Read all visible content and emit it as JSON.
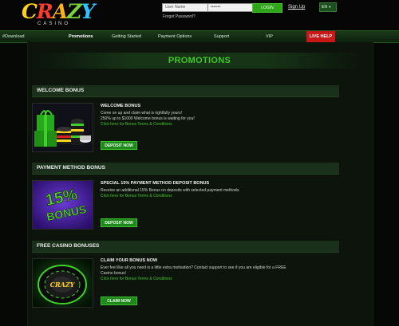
{
  "header": {
    "logo_main": "CRAZY",
    "logo_sub": "CASINO",
    "username_placeholder": "User Name",
    "password_placeholder": "•••••••",
    "login_label": "LOGIN",
    "signup_label": "Sign Up",
    "language": "EN",
    "forgot_password": "Forgot Password?"
  },
  "nav": {
    "items": [
      {
        "label": "#Download"
      },
      {
        "label": "Promotions"
      },
      {
        "label": "Getting Started"
      },
      {
        "label": "Payment Options"
      },
      {
        "label": "Support"
      },
      {
        "label": "VIP"
      }
    ],
    "live_help": "LIVE HELP"
  },
  "page_title": "PROMOTIONS",
  "sections": [
    {
      "bar_label": "WELCOME BONUS",
      "heading": "WELCOME BONUS",
      "lines": [
        "Come on up and claim what is rightfully yours!",
        "250% up to $1000 Welcome bonus is waiting for you!"
      ],
      "link": "Click here for Bonus Terms & Conditions",
      "button": "DEPOSIT NOW"
    },
    {
      "bar_label": "PAYMENT METHOD BONUS",
      "heading": "SPECIAL 15% PAYMENT METHOD DEPOSIT BONUS",
      "lines": [
        "Receive an additional 15% Bonus on deposits with selected payment methods."
      ],
      "link": "Click here for Bonus Terms & Conditions",
      "button": "DEPOSIT NOW",
      "thumb_text_top": "15%",
      "thumb_text_bottom": "BONUS"
    },
    {
      "bar_label": "FREE CASINO BONUSES",
      "heading": "CLAIM YOUR BONUS NOW",
      "lines": [
        "Ever feel like all you need is a little extra motivation? Contact support to see if you are eligible for a FREE",
        "Casino bonus!"
      ],
      "link": "Click here for Bonus Terms & Conditions",
      "button": "CLAIM NOW",
      "thumb_text_top": "CRAZY"
    }
  ],
  "colors": {
    "accent_green": "#40c728",
    "nav_green": "#1a3a1a",
    "live_help_red": "#c81818"
  }
}
